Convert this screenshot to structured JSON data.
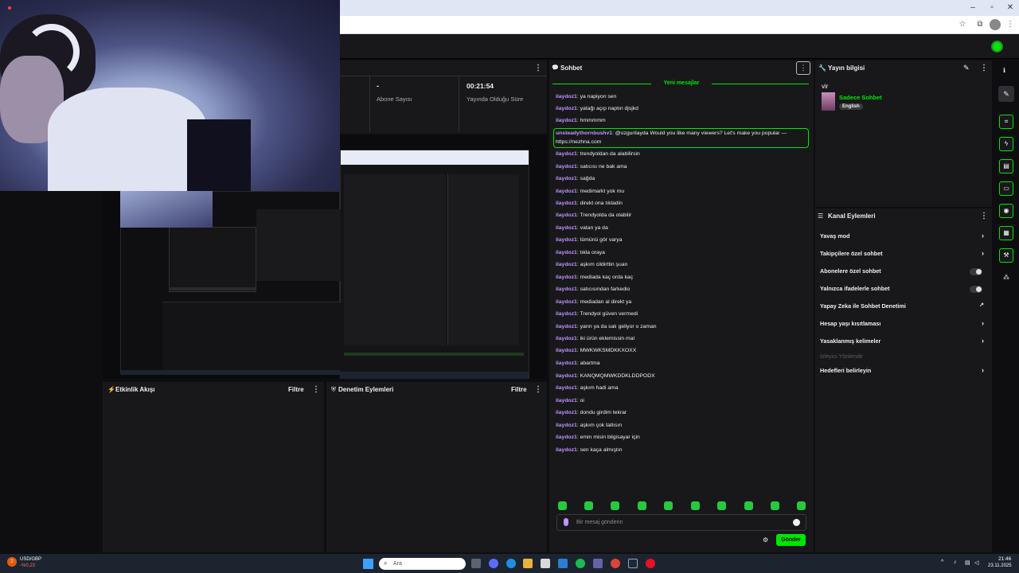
{
  "colors": {
    "accent_green": "#00e701",
    "username_purple": "#bf94ff",
    "panel_bg": "#18181b",
    "page_bg": "#0e0e10"
  },
  "stats": {
    "dash": "-",
    "subscriber_label": "Abone Sayısı",
    "uptime_value": "00:21:54",
    "uptime_label": "Yayında Olduğu Süre"
  },
  "panels": {
    "activity_feed": "Etkinlik Akışı",
    "activity_filter": "Filtre",
    "mod_actions": "Denetim Eylemleri",
    "mod_filter": "Filtre"
  },
  "chat": {
    "title": "Sohbet",
    "new_messages": "Yeni mesajlar",
    "messages": [
      {
        "user": "ilaydoz1",
        "text": ": ya napiyon sen"
      },
      {
        "user": "ilaydoz1",
        "text": ": yatağı açıp naptın djsjkd"
      },
      {
        "user": "ilaydoz1",
        "text": ": hmmmmm"
      },
      {
        "user": "unsteadythornbushv1",
        "text": ": @ozgurilayda Would you like many viewers? Let's make you popular —"
      },
      {
        "user": "",
        "text": "https://nezhna.com"
      },
      {
        "user": "ilaydoz1",
        "text": ": trendyoldan da alabilirsin"
      },
      {
        "user": "ilaydoz1",
        "text": ": satıcısı ne bak ama"
      },
      {
        "user": "ilaydoz1",
        "text": ": sağda"
      },
      {
        "user": "ilaydoz1",
        "text": ": medimarkt yok mu"
      },
      {
        "user": "ilaydoz1",
        "text": ": direkt ona tıkladin"
      },
      {
        "user": "ilaydoz1",
        "text": ": Trendyolda da olabilir"
      },
      {
        "user": "ilaydoz1",
        "text": ": vatan ya da"
      },
      {
        "user": "ilaydoz1",
        "text": ": tümünü gör varya"
      },
      {
        "user": "ilaydoz1",
        "text": ": tıkla oraya"
      },
      {
        "user": "ilaydoz1",
        "text": ": aşkım cildirttin şuan"
      },
      {
        "user": "ilaydoz1",
        "text": ": mediada kaç orda kaç"
      },
      {
        "user": "ilaydoz1",
        "text": ": satıcısından farkedio"
      },
      {
        "user": "ilaydoz1",
        "text": ": mediadan al direkt ya"
      },
      {
        "user": "ilaydoz1",
        "text": ": Trendyol güven vermedi"
      },
      {
        "user": "ilaydoz1",
        "text": ": yarın ya da salı geliyor o zaman"
      },
      {
        "user": "ilaydoz1",
        "text": ": iki ürün eklemissin mal"
      },
      {
        "user": "ilaydoz1",
        "text": ": MWKWKSMDKKXOXX"
      },
      {
        "user": "ilaydoz1",
        "text": ": abartma"
      },
      {
        "user": "ilaydoz1",
        "text": ": KANQMQMWKDDKLDDPODX"
      },
      {
        "user": "ilaydoz1",
        "text": ": aşkım hadi ama"
      },
      {
        "user": "ilaydoz1",
        "text": ": oi"
      },
      {
        "user": "ilaydoz1",
        "text": ": dondu girdim tekrar"
      },
      {
        "user": "ilaydoz1",
        "text": ": aşkım çok tatlısın"
      },
      {
        "user": "ilaydoz1",
        "text": ": emin misin bilgisayar için"
      },
      {
        "user": "ilaydoz1",
        "text": ": sen kaça almıştın"
      }
    ],
    "input_placeholder": "Bir mesaj gönderin",
    "send_label": "Gönder"
  },
  "stream_info": {
    "title": "Yayın bilgisi",
    "stream_title": "vir",
    "category": "Sadece Sohbet",
    "language": "English"
  },
  "channel_actions": {
    "title": "Kanal Eylemleri",
    "items": [
      {
        "label": "Yavaş mod",
        "control": "chevron"
      },
      {
        "label": "Takipçilere özel sohbet",
        "control": "chevron"
      },
      {
        "label": "Abonelere özel sohbet",
        "control": "toggle"
      },
      {
        "label": "Yalnızca ifadelerle sohbet",
        "control": "toggle"
      },
      {
        "label": "Yapay Zeka ile Sohbet Denetimi",
        "control": "external"
      },
      {
        "label": "Hesap yaşı kısıtlaması",
        "control": "chevron"
      },
      {
        "label": "Yasaklanmış kelimeler",
        "control": "chevron"
      },
      {
        "label": "İzleyici Yönlendir",
        "control": "none"
      },
      {
        "label": "Hedefleri belirleyin",
        "control": "chevron"
      }
    ]
  },
  "taskbar": {
    "ticker_symbol": "USD/GBP",
    "ticker_change": "-%0,23",
    "ticker_badge": "2",
    "search_placeholder": "Ara",
    "time": "21:46",
    "date": "23.11.2025"
  }
}
